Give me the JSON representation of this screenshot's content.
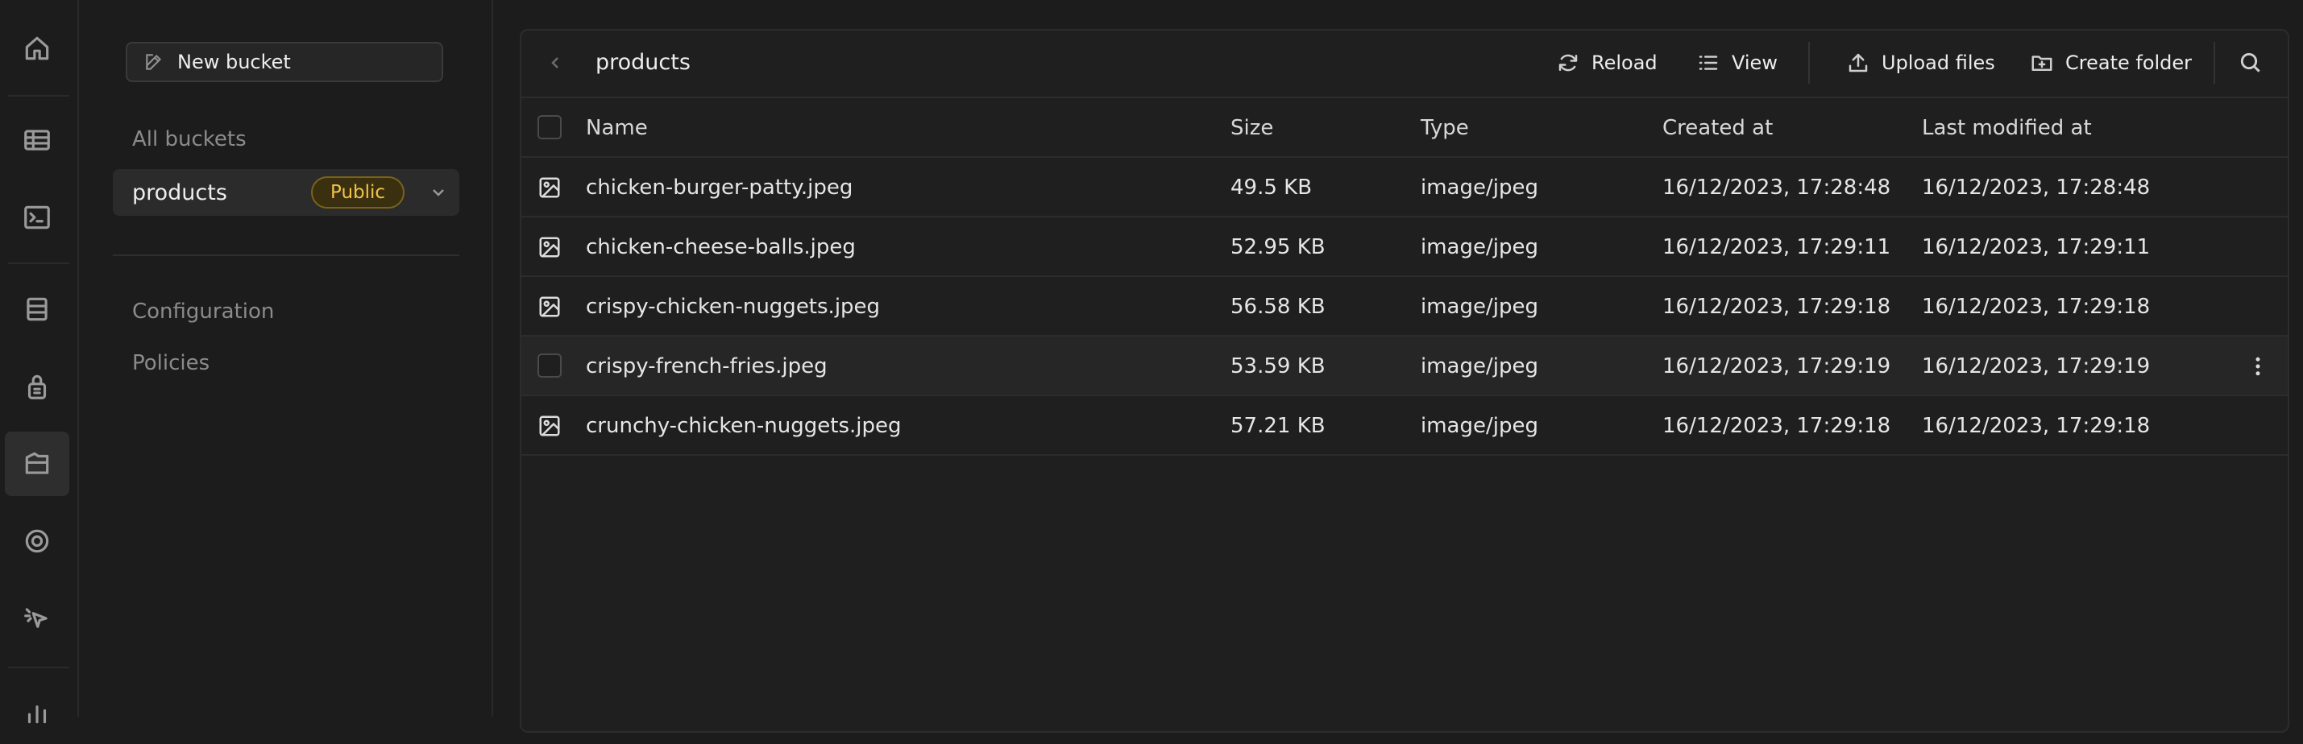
{
  "rail": {
    "icons": [
      "home-icon",
      "table-editor-icon",
      "sql-editor-icon",
      "database-icon",
      "auth-icon",
      "storage-icon",
      "realtime-icon",
      "edge-functions-icon",
      "reports-icon"
    ],
    "active": "storage-icon"
  },
  "sidebar": {
    "new_bucket_label": "New bucket",
    "all_buckets_label": "All buckets",
    "buckets": [
      {
        "name": "products",
        "badge": "Public"
      }
    ],
    "links": [
      "Configuration",
      "Policies"
    ]
  },
  "toolbar": {
    "breadcrumb": "products",
    "reload_label": "Reload",
    "view_label": "View",
    "upload_label": "Upload files",
    "create_folder_label": "Create folder"
  },
  "table": {
    "columns": [
      "Name",
      "Size",
      "Type",
      "Created at",
      "Last modified at"
    ],
    "rows": [
      {
        "name": "chicken-burger-patty.jpeg",
        "size": "49.5 KB",
        "type": "image/jpeg",
        "created": "16/12/2023, 17:28:48",
        "modified": "16/12/2023, 17:28:48"
      },
      {
        "name": "chicken-cheese-balls.jpeg",
        "size": "52.95 KB",
        "type": "image/jpeg",
        "created": "16/12/2023, 17:29:11",
        "modified": "16/12/2023, 17:29:11"
      },
      {
        "name": "crispy-chicken-nuggets.jpeg",
        "size": "56.58 KB",
        "type": "image/jpeg",
        "created": "16/12/2023, 17:29:18",
        "modified": "16/12/2023, 17:29:18"
      },
      {
        "name": "crispy-french-fries.jpeg",
        "size": "53.59 KB",
        "type": "image/jpeg",
        "created": "16/12/2023, 17:29:19",
        "modified": "16/12/2023, 17:29:19"
      },
      {
        "name": "crunchy-chicken-nuggets.jpeg",
        "size": "57.21 KB",
        "type": "image/jpeg",
        "created": "16/12/2023, 17:29:18",
        "modified": "16/12/2023, 17:29:18"
      }
    ],
    "hovered_row": 3
  },
  "colors": {
    "background": "#1c1c1c",
    "panel": "#1f1f1f",
    "badge_text": "#f1c34a",
    "badge_border": "#7a6319"
  }
}
